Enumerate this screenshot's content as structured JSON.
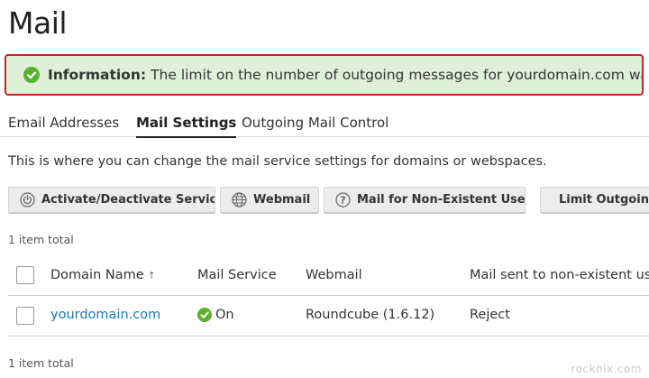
{
  "page": {
    "title": "Mail"
  },
  "alert": {
    "label": "Information:",
    "message": "The limit on the number of outgoing messages for yourdomain.com was updated."
  },
  "tabs": [
    {
      "label": "Email Addresses",
      "active": false
    },
    {
      "label": "Mail Settings",
      "active": true
    },
    {
      "label": "Outgoing Mail Control",
      "active": false
    }
  ],
  "description": "This is where you can change the mail service settings for domains or webspaces.",
  "toolbar": {
    "activate_label": "Activate/Deactivate Services",
    "activate_icon": "power-icon",
    "webmail_label": "Webmail",
    "webmail_icon": "globe-icon",
    "nonexistent_label": "Mail for Non-Existent Users",
    "nonexistent_icon": "question-icon",
    "limit_label": "Limit Outgoing Messages"
  },
  "list": {
    "count_top": "1 item total",
    "count_bottom": "1 item total",
    "columns": {
      "domain": "Domain Name",
      "sort_indicator": "↑",
      "mail_service": "Mail Service",
      "webmail": "Webmail",
      "non_existent": "Mail sent to non-existent users"
    },
    "rows": [
      {
        "domain": "yourdomain.com",
        "mail_service": "On",
        "webmail": "Roundcube (1.6.12)",
        "non_existent": "Reject"
      }
    ]
  },
  "watermark": "rocknix.com",
  "colors": {
    "alert_background": "#dff0d8",
    "alert_border": "#c0262f",
    "success_green": "#5cb030",
    "link": "#1f78b4"
  }
}
